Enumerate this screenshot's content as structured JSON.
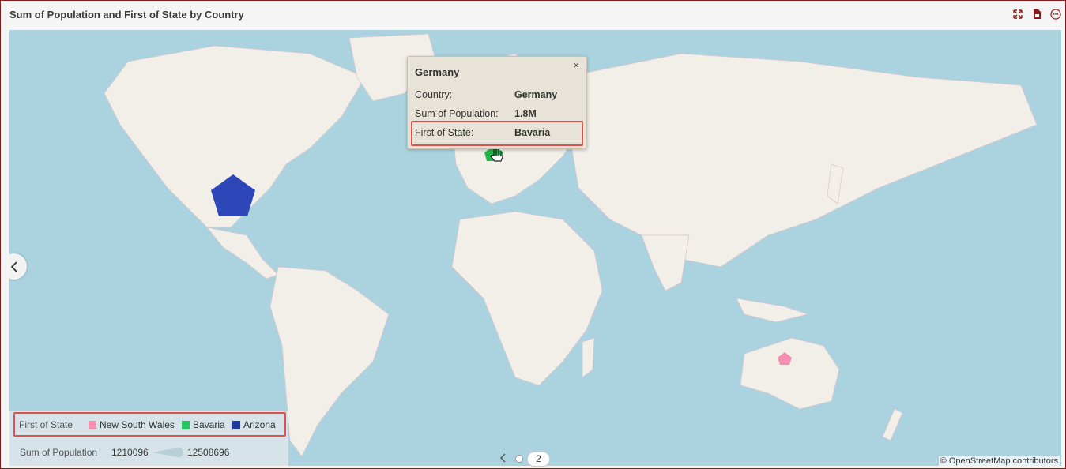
{
  "title": "Sum of Population and First of State by Country",
  "header_icons": [
    "expand-icon",
    "pdf-export-icon",
    "more-options-icon"
  ],
  "tooltip": {
    "heading": "Germany",
    "close": "×",
    "rows": [
      {
        "label": "Country:",
        "value": "Germany"
      },
      {
        "label": "Sum of Population:",
        "value": "1.8M"
      },
      {
        "label": "First of State:",
        "value": "Bavaria"
      }
    ]
  },
  "legend": {
    "state_title": "First of State",
    "items": [
      {
        "label": "New South Wales",
        "color": "#f48fb1"
      },
      {
        "label": "Bavaria",
        "color": "#22c55e"
      },
      {
        "label": "Arizona",
        "color": "#1e3aa0"
      }
    ],
    "population_title": "Sum of Population",
    "pop_min": "1210096",
    "pop_max": "12508696"
  },
  "pager": {
    "page": "2"
  },
  "attribution": "© OpenStreetMap contributors",
  "markers": [
    {
      "name": "arizona-marker",
      "color": "#2e47b8"
    },
    {
      "name": "bavaria-marker",
      "color": "#1fb84a"
    },
    {
      "name": "new-south-wales-marker",
      "color": "#f48fb1"
    }
  ]
}
